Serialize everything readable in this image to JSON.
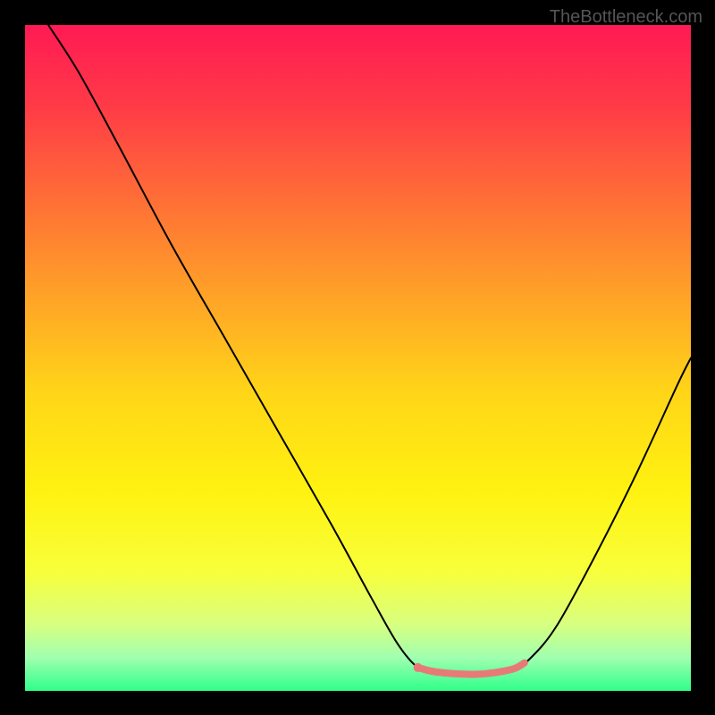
{
  "watermark": "TheBottleneck.com",
  "chart_data": {
    "type": "line",
    "title": "",
    "xlabel": "",
    "ylabel": "",
    "xlim": [
      0,
      100
    ],
    "ylim": [
      0,
      100
    ],
    "gradient_stops": [
      {
        "offset": 0.0,
        "color": "#ff1a54"
      },
      {
        "offset": 0.12,
        "color": "#ff3a47"
      },
      {
        "offset": 0.25,
        "color": "#ff6a38"
      },
      {
        "offset": 0.4,
        "color": "#ffa028"
      },
      {
        "offset": 0.55,
        "color": "#ffd518"
      },
      {
        "offset": 0.7,
        "color": "#fff210"
      },
      {
        "offset": 0.82,
        "color": "#f8ff3a"
      },
      {
        "offset": 0.9,
        "color": "#d8ff80"
      },
      {
        "offset": 0.95,
        "color": "#a0ffb0"
      },
      {
        "offset": 1.0,
        "color": "#2fff8a"
      }
    ],
    "series": [
      {
        "name": "bottleneck-curve",
        "stroke": "#000000",
        "stroke_width": 2,
        "points": [
          {
            "x": 3.5,
            "y": 100
          },
          {
            "x": 8,
            "y": 93
          },
          {
            "x": 14,
            "y": 82
          },
          {
            "x": 22,
            "y": 67
          },
          {
            "x": 30,
            "y": 53
          },
          {
            "x": 38,
            "y": 39
          },
          {
            "x": 46,
            "y": 25
          },
          {
            "x": 52,
            "y": 14
          },
          {
            "x": 56,
            "y": 7
          },
          {
            "x": 59,
            "y": 3.5
          },
          {
            "x": 62,
            "y": 2.5
          },
          {
            "x": 68,
            "y": 2.5
          },
          {
            "x": 73,
            "y": 3
          },
          {
            "x": 76,
            "y": 5
          },
          {
            "x": 80,
            "y": 10
          },
          {
            "x": 86,
            "y": 21
          },
          {
            "x": 92,
            "y": 33
          },
          {
            "x": 98,
            "y": 46
          },
          {
            "x": 100,
            "y": 50
          }
        ]
      }
    ],
    "highlight_segment": {
      "color": "#e77a77",
      "stroke_width": 8,
      "points": [
        {
          "x": 59,
          "y": 3.5
        },
        {
          "x": 62,
          "y": 2.8
        },
        {
          "x": 68,
          "y": 2.5
        },
        {
          "x": 73,
          "y": 3.2
        },
        {
          "x": 75,
          "y": 4.2
        }
      ],
      "dot": {
        "x": 59,
        "y": 3.5,
        "r": 5
      }
    }
  }
}
